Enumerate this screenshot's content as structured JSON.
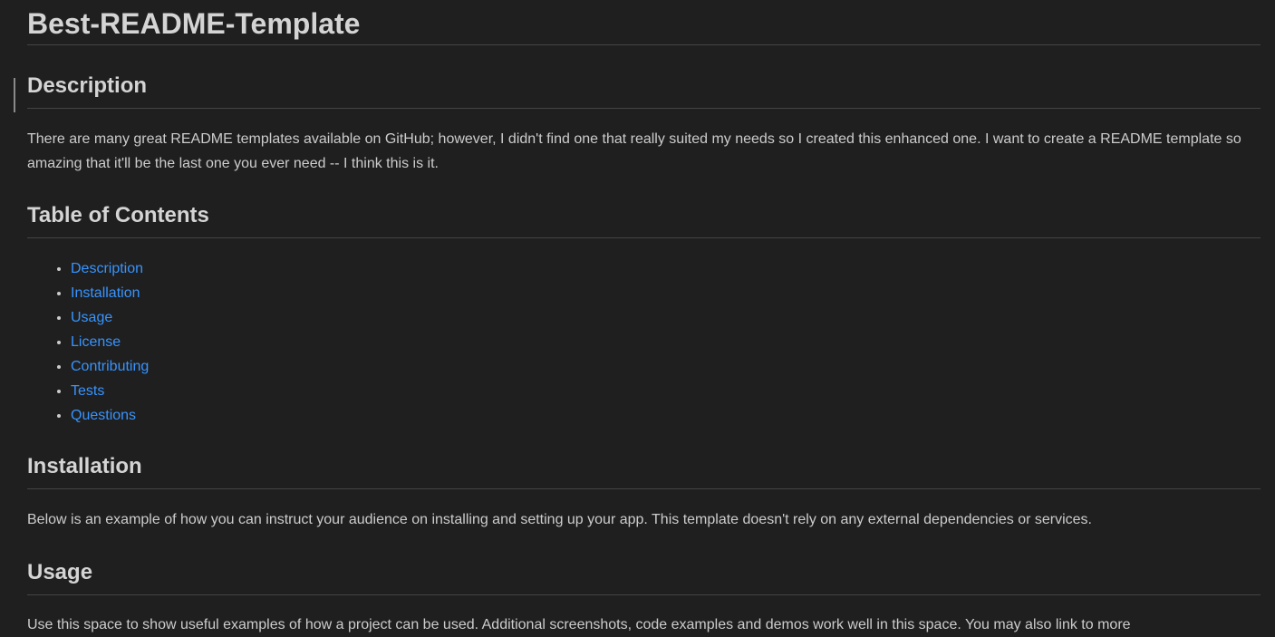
{
  "title": "Best-README-Template",
  "sections": {
    "description": {
      "heading": "Description",
      "text": "There are many great README templates available on GitHub; however, I didn't find one that really suited my needs so I created this enhanced one. I want to create a README template so amazing that it'll be the last one you ever need -- I think this is it."
    },
    "toc": {
      "heading": "Table of Contents",
      "items": [
        "Description",
        "Installation",
        "Usage",
        "License",
        "Contributing",
        "Tests",
        "Questions"
      ]
    },
    "installation": {
      "heading": "Installation",
      "text": "Below is an example of how you can instruct your audience on installing and setting up your app. This template doesn't rely on any external dependencies or services."
    },
    "usage": {
      "heading": "Usage",
      "text": "Use this space to show useful examples of how a project can be used. Additional screenshots, code examples and demos work well in this space. You may also link to more"
    }
  },
  "colors": {
    "background": "#1f1f1f",
    "text": "#cccccc",
    "heading": "#d4d4d4",
    "link": "#3794ff",
    "rule": "#444444"
  }
}
